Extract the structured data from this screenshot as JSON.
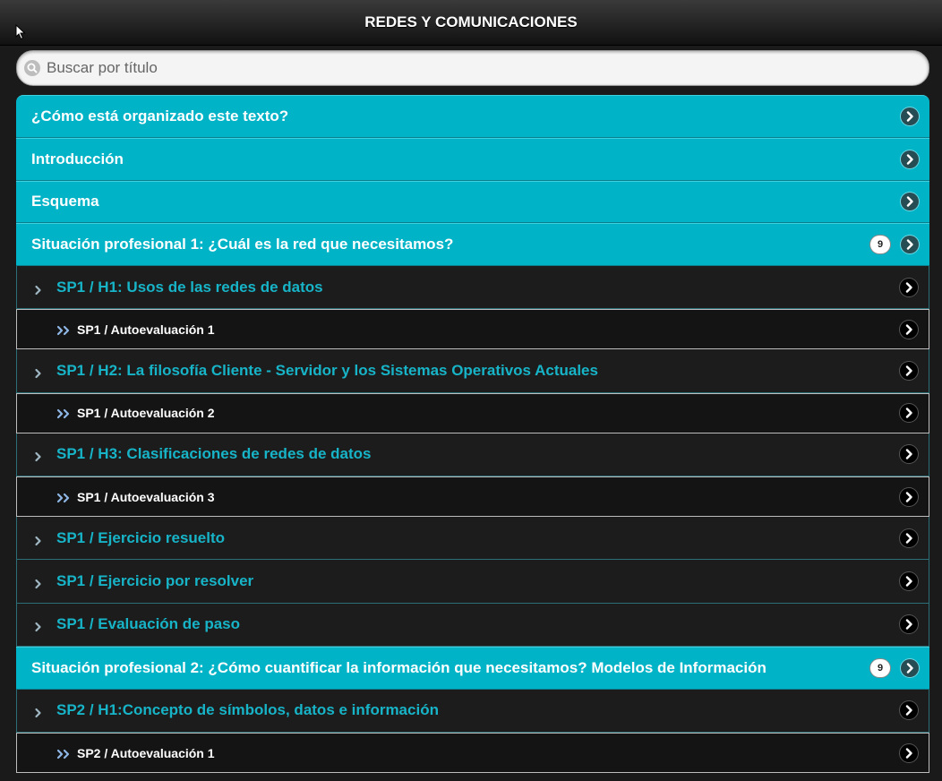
{
  "header": {
    "title": "REDES Y COMUNICACIONES"
  },
  "search": {
    "placeholder": "Buscar por título",
    "value": ""
  },
  "colors": {
    "accent": "#00b3c7",
    "sub_text": "#17b4c8",
    "background": "#1a1a1a"
  },
  "items": [
    {
      "type": "cat",
      "label": "¿Cómo está organizado este texto?"
    },
    {
      "type": "cat",
      "label": "Introducción"
    },
    {
      "type": "cat",
      "label": "Esquema"
    },
    {
      "type": "cat",
      "label": "Situación profesional 1: ¿Cuál es la red que necesitamos?",
      "count": "9"
    },
    {
      "type": "sub",
      "label": "SP1 / H1: Usos de las redes de datos"
    },
    {
      "type": "auto",
      "label": "SP1 / Autoevaluación 1"
    },
    {
      "type": "sub",
      "label": "SP1 / H2: La filosofía Cliente - Servidor y los Sistemas Operativos Actuales"
    },
    {
      "type": "auto",
      "label": "SP1 / Autoevaluación 2"
    },
    {
      "type": "sub",
      "label": "SP1 / H3: Clasificaciones de redes de datos"
    },
    {
      "type": "auto",
      "label": "SP1 / Autoevaluación 3"
    },
    {
      "type": "sub",
      "label": "SP1 / Ejercicio resuelto"
    },
    {
      "type": "sub",
      "label": "SP1 / Ejercicio por resolver"
    },
    {
      "type": "sub",
      "label": "SP1 / Evaluación de paso"
    },
    {
      "type": "cat",
      "label": "Situación profesional 2: ¿Cómo cuantificar la información que necesitamos? Modelos de Información",
      "count": "9"
    },
    {
      "type": "sub",
      "label": "SP2 / H1:Concepto de símbolos, datos e información"
    },
    {
      "type": "auto",
      "label": "SP2 / Autoevaluación 1"
    }
  ]
}
